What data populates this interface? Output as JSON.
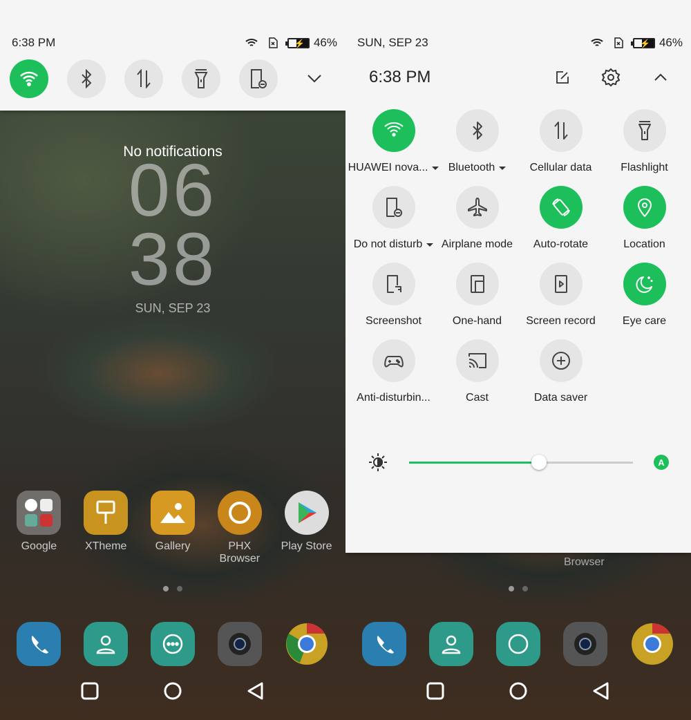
{
  "accent": "#1dbf5a",
  "left": {
    "status": {
      "time": "6:38 PM",
      "battery": "46%"
    },
    "quick_toggles": [
      {
        "name": "wifi",
        "icon": "wifi-icon",
        "on": true
      },
      {
        "name": "bluetooth",
        "icon": "bluetooth-icon",
        "on": false
      },
      {
        "name": "cellular-data",
        "icon": "cellular-data-icon",
        "on": false
      },
      {
        "name": "flashlight",
        "icon": "flashlight-icon",
        "on": false
      },
      {
        "name": "do-not-disturb",
        "icon": "do-not-disturb-icon",
        "on": false
      }
    ],
    "no_notifications": "No notifications",
    "clock": {
      "hour": "06",
      "minute": "38",
      "date": "SUN, SEP 23"
    },
    "apps": [
      {
        "label": "Google"
      },
      {
        "label": "XTheme"
      },
      {
        "label": "Gallery"
      },
      {
        "label": "PHX Browser"
      },
      {
        "label": "Play Store"
      }
    ],
    "dock": [
      "phone",
      "contacts",
      "messages",
      "camera",
      "chrome"
    ]
  },
  "right": {
    "status": {
      "date": "SUN, SEP 23",
      "battery": "46%"
    },
    "header": {
      "time": "6:38 PM"
    },
    "tiles": [
      {
        "label": "HUAWEI nova...",
        "icon": "wifi-icon",
        "on": true,
        "dropdown": true
      },
      {
        "label": "Bluetooth",
        "icon": "bluetooth-icon",
        "on": false,
        "dropdown": true
      },
      {
        "label": "Cellular data",
        "icon": "cellular-data-icon",
        "on": false
      },
      {
        "label": "Flashlight",
        "icon": "flashlight-icon",
        "on": false
      },
      {
        "label": "Do not disturb",
        "icon": "do-not-disturb-icon",
        "on": false,
        "dropdown": true
      },
      {
        "label": "Airplane mode",
        "icon": "airplane-icon",
        "on": false
      },
      {
        "label": "Auto-rotate",
        "icon": "auto-rotate-icon",
        "on": true
      },
      {
        "label": "Location",
        "icon": "location-icon",
        "on": true
      },
      {
        "label": "Screenshot",
        "icon": "screenshot-icon",
        "on": false
      },
      {
        "label": "One-hand",
        "icon": "one-hand-icon",
        "on": false
      },
      {
        "label": "Screen record",
        "icon": "screen-record-icon",
        "on": false
      },
      {
        "label": "Eye care",
        "icon": "eye-care-icon",
        "on": true
      },
      {
        "label": "Anti-disturbin...",
        "icon": "gamepad-icon",
        "on": false
      },
      {
        "label": "Cast",
        "icon": "cast-icon",
        "on": false
      },
      {
        "label": "Data saver",
        "icon": "data-saver-icon",
        "on": false
      }
    ],
    "brightness": {
      "value_percent": 58,
      "auto": true
    },
    "background_app_label": "Browser"
  }
}
